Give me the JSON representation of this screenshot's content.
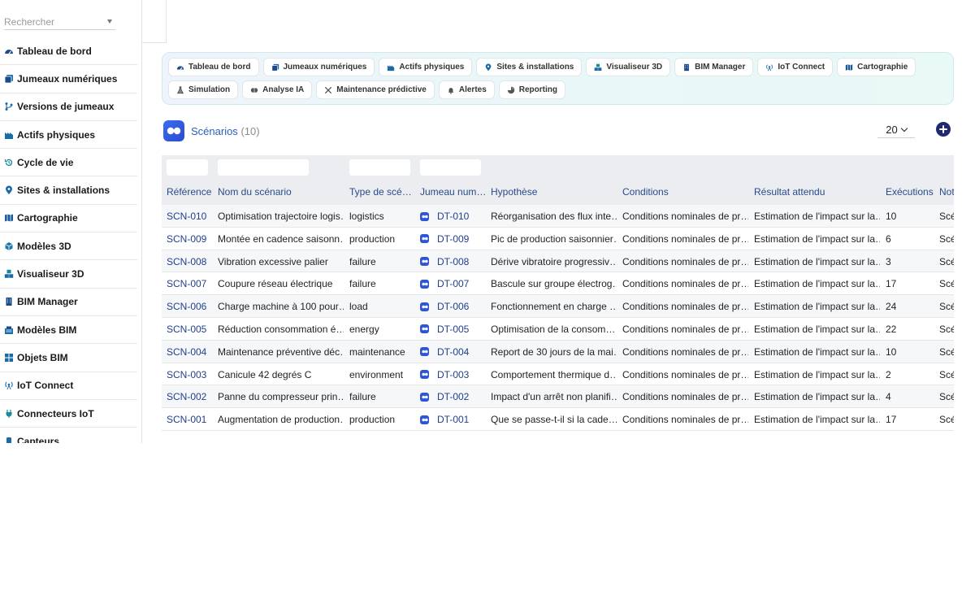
{
  "search": {
    "placeholder": "Rechercher"
  },
  "sidebar": {
    "items": [
      {
        "label": "Tableau de bord",
        "icon": "dashboard-icon"
      },
      {
        "label": "Jumeaux numériques",
        "icon": "copy-icon"
      },
      {
        "label": "Versions de jumeaux",
        "icon": "branch-icon"
      },
      {
        "label": "Actifs physiques",
        "icon": "factory-icon"
      },
      {
        "label": "Cycle de vie",
        "icon": "history-icon"
      },
      {
        "label": "Sites & installations",
        "icon": "map-pin-icon"
      },
      {
        "label": "Cartographie",
        "icon": "map-icon"
      },
      {
        "label": "Modèles 3D",
        "icon": "cube-icon"
      },
      {
        "label": "Visualiseur 3D",
        "icon": "cubes-icon"
      },
      {
        "label": "BIM Manager",
        "icon": "building-icon"
      },
      {
        "label": "Modèles BIM",
        "icon": "city-icon"
      },
      {
        "label": "Objets BIM",
        "icon": "grid-icon"
      },
      {
        "label": "IoT Connect",
        "icon": "antenna-icon"
      },
      {
        "label": "Connecteurs IoT",
        "icon": "plug-icon"
      },
      {
        "label": "Capteurs",
        "icon": "sensor-icon"
      }
    ]
  },
  "modules": [
    {
      "label": "Tableau de bord",
      "icon": "dashboard-icon"
    },
    {
      "label": "Jumeaux numériques",
      "icon": "copy-icon"
    },
    {
      "label": "Actifs physiques",
      "icon": "factory-icon"
    },
    {
      "label": "Sites & installations",
      "icon": "map-pin-icon"
    },
    {
      "label": "Visualiseur 3D",
      "icon": "cubes-icon"
    },
    {
      "label": "BIM Manager",
      "icon": "building-icon"
    },
    {
      "label": "IoT Connect",
      "icon": "antenna-icon"
    },
    {
      "label": "Cartographie",
      "icon": "map-icon"
    },
    {
      "label": "Simulation",
      "icon": "flask-icon"
    },
    {
      "label": "Analyse IA",
      "icon": "brain-icon"
    },
    {
      "label": "Maintenance prédictive",
      "icon": "tools-icon"
    },
    {
      "label": "Alertes",
      "icon": "bell-icon"
    },
    {
      "label": "Reporting",
      "icon": "chart-pie-icon"
    }
  ],
  "header": {
    "title": "Scénarios",
    "count": "(10)",
    "page_size": "20"
  },
  "table": {
    "columns": [
      "Référence",
      "Nom du scénario",
      "Type de scé…",
      "Jumeau num…",
      "Hypothèse",
      "Conditions",
      "Résultat attendu",
      "Exécutions",
      "Note"
    ],
    "rows": [
      [
        "SCN-010",
        "Optimisation trajectoire logis…",
        "logistics",
        "DT-010",
        "Réorganisation des flux inte…",
        "Conditions nominales de pr…",
        "Estimation de l'impact sur la…",
        "10",
        "Scé"
      ],
      [
        "SCN-009",
        "Montée en cadence saisonn…",
        "production",
        "DT-009",
        "Pic de production saisonnier…",
        "Conditions nominales de pr…",
        "Estimation de l'impact sur la…",
        "6",
        "Scé"
      ],
      [
        "SCN-008",
        "Vibration excessive palier",
        "failure",
        "DT-008",
        "Dérive vibratoire progressiv…",
        "Conditions nominales de pr…",
        "Estimation de l'impact sur la…",
        "3",
        "Scé"
      ],
      [
        "SCN-007",
        "Coupure réseau électrique",
        "failure",
        "DT-007",
        "Bascule sur groupe électrog…",
        "Conditions nominales de pr…",
        "Estimation de l'impact sur la…",
        "17",
        "Scé"
      ],
      [
        "SCN-006",
        "Charge machine à 100 pour…",
        "load",
        "DT-006",
        "Fonctionnement en charge …",
        "Conditions nominales de pr…",
        "Estimation de l'impact sur la…",
        "24",
        "Scé"
      ],
      [
        "SCN-005",
        "Réduction consommation é…",
        "energy",
        "DT-005",
        "Optimisation de la consom…",
        "Conditions nominales de pr…",
        "Estimation de l'impact sur la…",
        "22",
        "Scé"
      ],
      [
        "SCN-004",
        "Maintenance préventive déc…",
        "maintenance",
        "DT-004",
        "Report de 30 jours de la mai…",
        "Conditions nominales de pr…",
        "Estimation de l'impact sur la…",
        "10",
        "Scé"
      ],
      [
        "SCN-003",
        "Canicule 42 degrés C",
        "environment",
        "DT-003",
        "Comportement thermique d…",
        "Conditions nominales de pr…",
        "Estimation de l'impact sur la…",
        "2",
        "Scé"
      ],
      [
        "SCN-002",
        "Panne du compresseur prin…",
        "failure",
        "DT-002",
        "Impact d'un arrêt non planifi…",
        "Conditions nominales de pr…",
        "Estimation de l'impact sur la…",
        "4",
        "Scé"
      ],
      [
        "SCN-001",
        "Augmentation de production…",
        "production",
        "DT-001",
        "Que se passe-t-il si la cade…",
        "Conditions nominales de pr…",
        "Estimation de l'impact sur la…",
        "17",
        "Scé"
      ]
    ]
  }
}
